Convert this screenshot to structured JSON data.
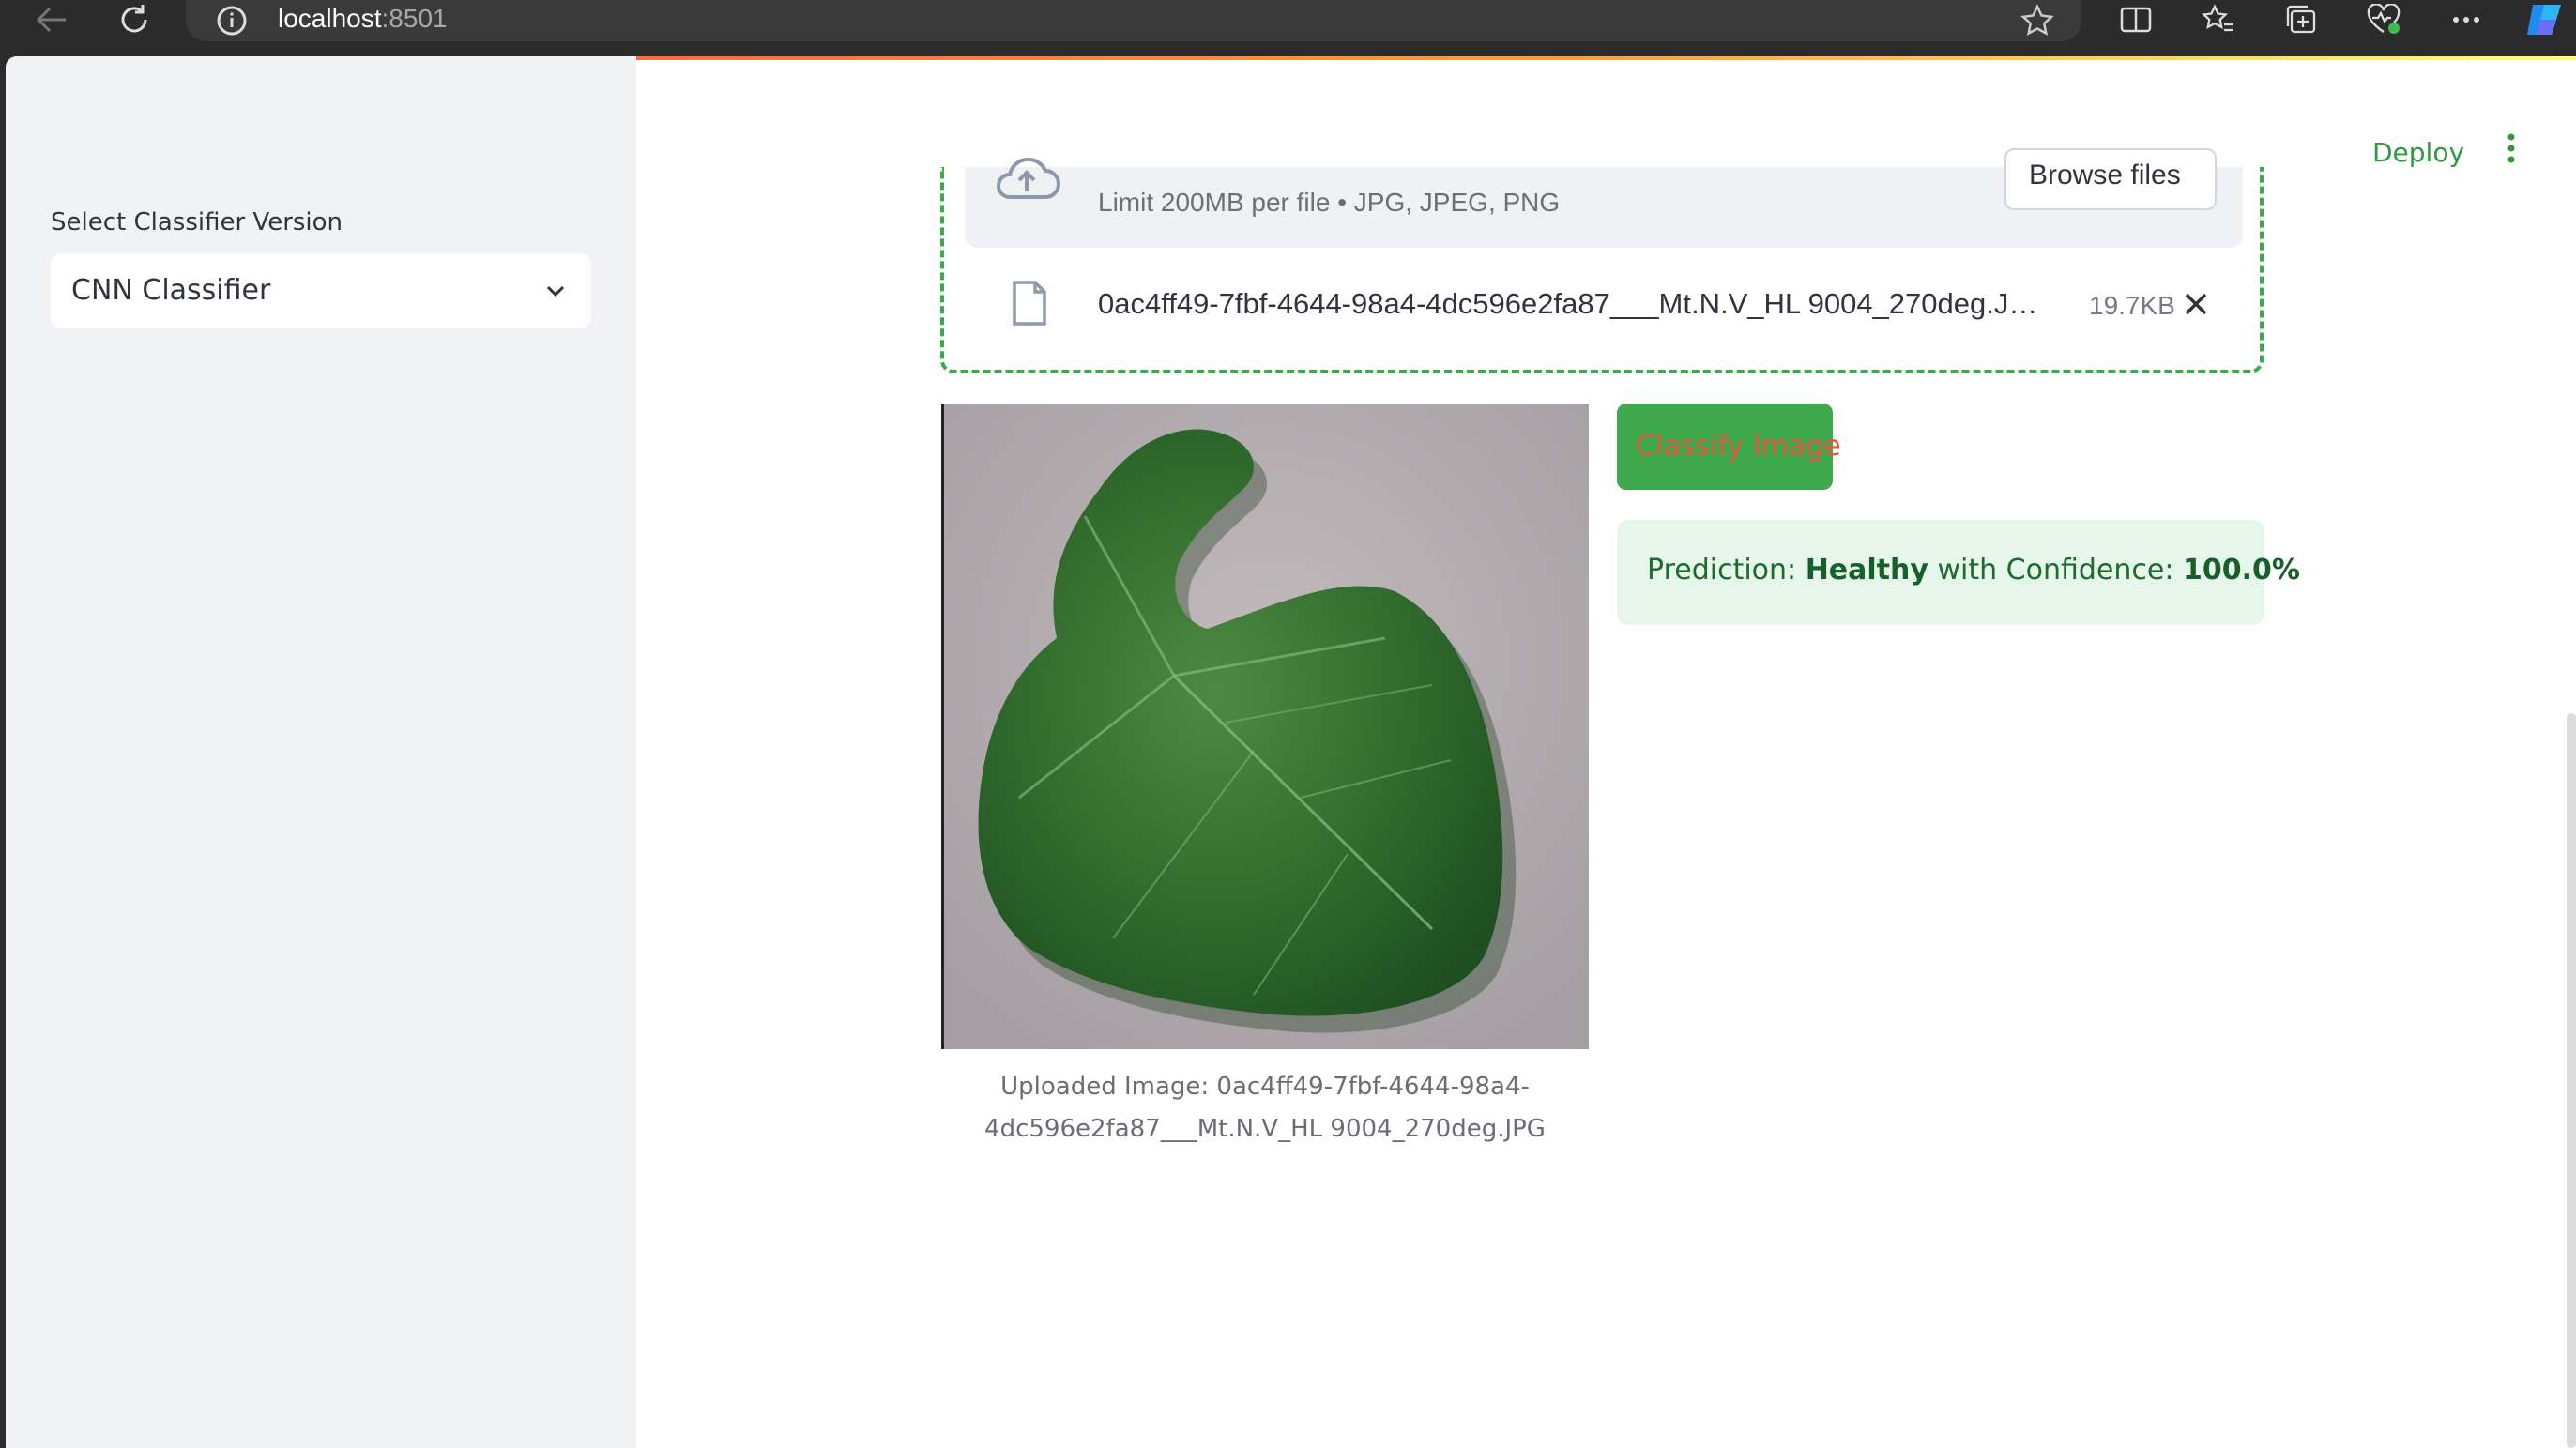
{
  "browser": {
    "url_host": "localhost",
    "url_port": ":8501"
  },
  "sidebar": {
    "select_label": "Select Classifier Version",
    "select_value": "CNN Classifier"
  },
  "header": {
    "deploy_label": "Deploy"
  },
  "uploader": {
    "limit_text": "Limit 200MB per file • JPG, JPEG, PNG",
    "browse_label": "Browse files",
    "file_name": "0ac4ff49-7fbf-4644-98a4-4dc596e2fa87___Mt.N.V_HL 9004_270deg.J…",
    "file_size": "19.7KB"
  },
  "image": {
    "caption_line1": "Uploaded Image: 0ac4ff49-7fbf-4644-98a4-",
    "caption_line2": "4dc596e2fa87___Mt.N.V_HL 9004_270deg.JPG"
  },
  "actions": {
    "classify_label": "Classify Image"
  },
  "result": {
    "prefix": "Prediction: ",
    "label": "Healthy",
    "middle": " with Confidence: ",
    "confidence": "100.0%"
  },
  "colors": {
    "accent_green": "#3ea84c",
    "success_bg": "#e6f6eb",
    "sidebar_bg": "#f0f2f6"
  }
}
